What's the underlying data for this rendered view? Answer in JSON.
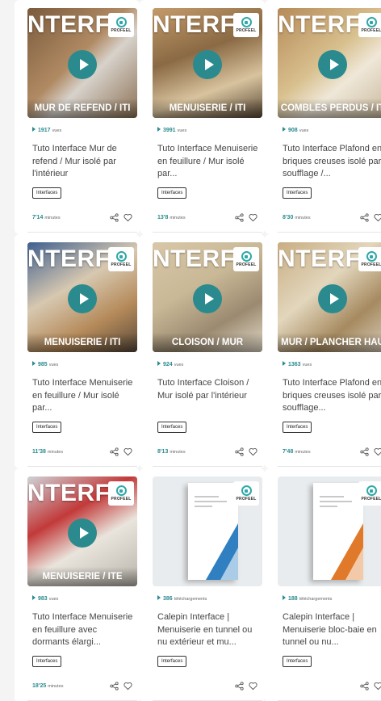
{
  "brand": {
    "badge_text": "PROFEEL",
    "accent": "#2a8a8e",
    "badge_ring": "#2fa8a8"
  },
  "cards": [
    {
      "kind": "video",
      "big_word": "NTERFA",
      "caption": "MUR DE REFEND / ITI",
      "views": "1917",
      "views_unit": "vues",
      "title": "Tuto Interface Mur de refend / Mur isolé par l'intérieur",
      "tag": "Interfaces",
      "duration": "7'14",
      "duration_unit": "minutes"
    },
    {
      "kind": "video",
      "big_word": "NTERFA",
      "caption": "MENUISERIE / ITI",
      "views": "3991",
      "views_unit": "vues",
      "title": "Tuto Interface Menuiserie en feuillure / Mur isolé par...",
      "tag": "Interfaces",
      "duration": "13'8",
      "duration_unit": "minutes"
    },
    {
      "kind": "video",
      "big_word": "NTERFA",
      "caption": "COMBLES PERDUS / IT",
      "views": "908",
      "views_unit": "vues",
      "title": "Tuto Interface Plafond en briques creuses isolé par soufflage /...",
      "tag": "Interfaces",
      "duration": "8'30",
      "duration_unit": "minutes"
    },
    {
      "kind": "video",
      "big_word": "NTERFA",
      "caption": "MENUISERIE / ITI",
      "views": "985",
      "views_unit": "vues",
      "title": "Tuto Interface Menuiserie en feuillure / Mur isolé par...",
      "tag": "Interfaces",
      "duration": "11'38",
      "duration_unit": "minutes"
    },
    {
      "kind": "video",
      "big_word": "NTERFA",
      "caption": "CLOISON / MUR",
      "views": "924",
      "views_unit": "vues",
      "title": "Tuto Interface Cloison / Mur isolé par l'intérieur",
      "tag": "Interfaces",
      "duration": "8'13",
      "duration_unit": "minutes"
    },
    {
      "kind": "video",
      "big_word": "NTERFA",
      "caption": "MUR / PLANCHER HAU",
      "views": "1363",
      "views_unit": "vues",
      "title": "Tuto Interface Plafond en briques creuses isolé par soufflage...",
      "tag": "Interfaces",
      "duration": "7'48",
      "duration_unit": "minutes"
    },
    {
      "kind": "video",
      "big_word": "NTERFA",
      "caption": "MENUISERIE / ITE",
      "views": "983",
      "views_unit": "vues",
      "title": "Tuto Interface Menuiserie en feuillure avec dormants élargi...",
      "tag": "Interfaces",
      "duration": "18'25",
      "duration_unit": "minutes"
    },
    {
      "kind": "doc",
      "views": "386",
      "views_unit": "téléchargements",
      "title": "Calepin Interface | Menuiserie en tunnel ou nu extérieur et mu...",
      "tag": "Interfaces",
      "doc_color": "#2f7fc1"
    },
    {
      "kind": "doc",
      "views": "188",
      "views_unit": "téléchargements",
      "title": "Calepin Interface | Menuiserie bloc-baie en tunnel ou nu...",
      "tag": "Interfaces",
      "doc_color": "#e07a2a"
    }
  ]
}
